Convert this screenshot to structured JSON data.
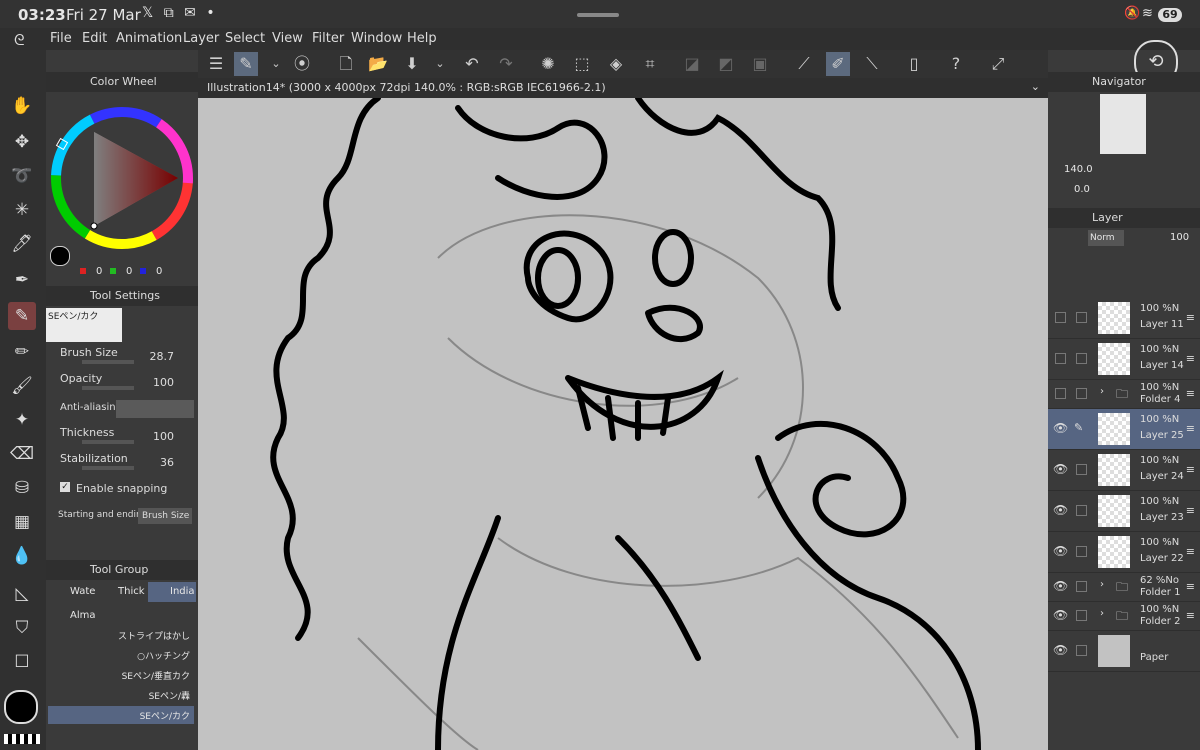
{
  "status": {
    "time": "03:23",
    "date": "Fri 27 Mar",
    "notifications": "𝕏 ⧉ ✉ •",
    "battery": "69"
  },
  "menu": [
    "File",
    "Edit",
    "Animation",
    "Layer",
    "Select",
    "View",
    "Filter",
    "Window",
    "Help"
  ],
  "document": {
    "tab": "Illustration14* (3000 x 4000px 72dpi 140.0% : RGB:sRGB IEC61966-2.1)"
  },
  "color_wheel": {
    "title": "Color Wheel",
    "r": "0",
    "g": "0",
    "b": "0"
  },
  "tool_settings": {
    "title": "Tool Settings",
    "brush": "SEペン/カク",
    "brush_size_label": "Brush Size",
    "brush_size": "28.7",
    "opacity_label": "Opacity",
    "opacity": "100",
    "aa_label": "Anti-aliasing",
    "thickness_label": "Thickness",
    "thickness": "100",
    "stabilization_label": "Stabilization",
    "stabilization": "36",
    "snapping_label": "Enable snapping",
    "start_end_label": "Starting and ending",
    "start_end_value": "Brush Size"
  },
  "tool_group": {
    "title": "Tool Group",
    "tabs": [
      "Wate",
      "Thick",
      "India",
      "Alma"
    ],
    "brushes": [
      "ストライプはかし",
      "○ハッチング",
      "SEペン/垂直カク",
      "SEペン/轟",
      "SEペン/カク"
    ]
  },
  "navigator": {
    "title": "Navigator",
    "zoom": "140.0",
    "rotation": "0.0"
  },
  "layer_panel": {
    "title": "Layer",
    "blend": "Norm",
    "opacity": "100",
    "layers": [
      {
        "pct": "100 %N",
        "name": "Layer 11"
      },
      {
        "pct": "100 %N",
        "name": "Layer 14"
      },
      {
        "pct": "100 %N",
        "name": "Folder 4"
      },
      {
        "pct": "100 %N",
        "name": "Layer 25"
      },
      {
        "pct": "100 %N",
        "name": "Layer 24"
      },
      {
        "pct": "100 %N",
        "name": "Layer 23"
      },
      {
        "pct": "100 %N",
        "name": "Layer 22"
      },
      {
        "pct": "62 %No",
        "name": "Folder 1"
      },
      {
        "pct": "100 %N",
        "name": "Folder 2"
      },
      {
        "pct": "",
        "name": "Paper"
      }
    ]
  }
}
